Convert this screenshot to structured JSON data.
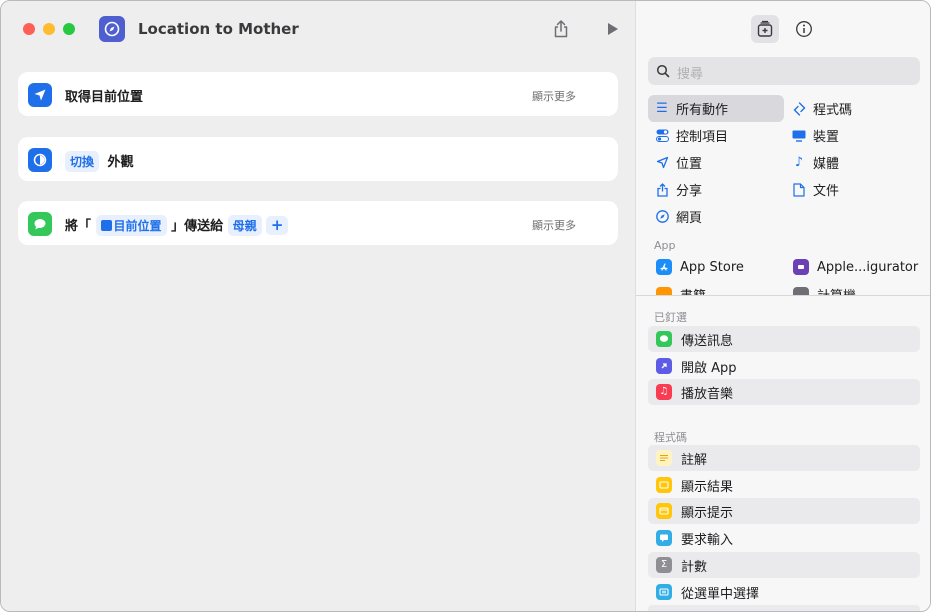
{
  "window": {
    "title": "Location to Mother"
  },
  "actions": [
    {
      "label": "取得目前位置",
      "more": "顯示更多"
    },
    {
      "verb": "切換",
      "label": "外觀"
    },
    {
      "prefix": "將「",
      "token": "目前位置",
      "mid": "」傳送給",
      "recipient": "母親",
      "plus": "+",
      "more": "顯示更多"
    }
  ],
  "sidebar": {
    "search_placeholder": "搜尋",
    "categories_left": [
      "所有動作",
      "控制項目",
      "位置",
      "分享",
      "網頁"
    ],
    "categories_right": [
      "程式碼",
      "裝置",
      "媒體",
      "文件"
    ],
    "app_section": "App",
    "apps": [
      "App Store",
      "Apple...igurator",
      "書籍",
      "計算機"
    ],
    "pinned_section": "已釘選",
    "pinned": [
      "傳送訊息",
      "開啟 App",
      "播放音樂"
    ],
    "scripting_section": "程式碼",
    "scripting": [
      "註解",
      "顯示結果",
      "顯示提示",
      "要求輸入",
      "計數",
      "從選單中選擇"
    ]
  },
  "colors": {
    "accent": "#1f6feb",
    "shortcut_icon": "#4f5fd0",
    "messages_green": "#34c759",
    "music_red": "#fa3c53",
    "open_app_purple": "#5e5ce6",
    "scripting_yellow": "#ffc60a",
    "ask_cyan": "#32ade6",
    "count_gray": "#8e8e93"
  }
}
